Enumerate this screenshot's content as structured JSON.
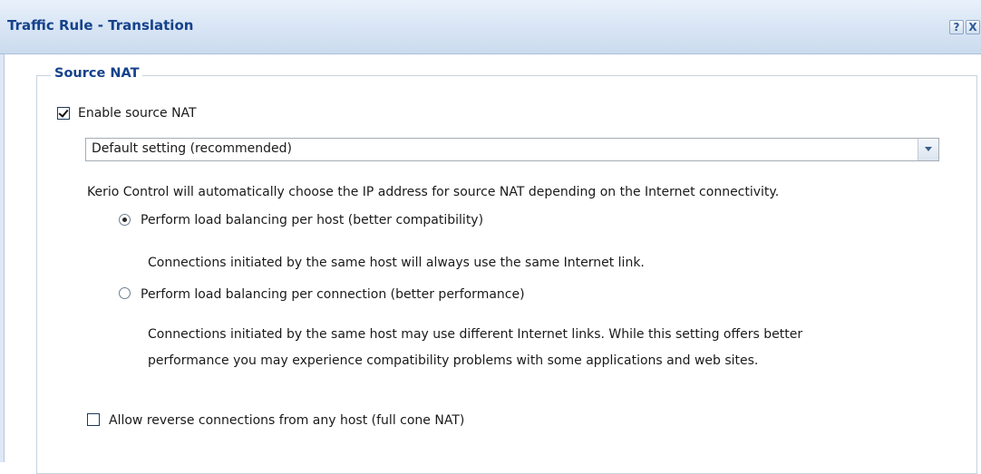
{
  "window": {
    "title": "Traffic Rule - Translation",
    "help_label": "?",
    "close_label": "X"
  },
  "source_nat": {
    "legend": "Source NAT",
    "enable_label": "Enable source NAT",
    "enable_checked": true,
    "mode_select": {
      "value": "Default setting (recommended)"
    },
    "description": "Kerio Control will automatically choose the IP address for source NAT depending on the Internet connectivity.",
    "options": [
      {
        "label": "Perform load balancing per host (better compatibility)",
        "selected": true,
        "help": "Connections initiated by the same host will always use the same Internet link."
      },
      {
        "label": "Perform load balancing per connection (better performance)",
        "selected": false,
        "help_line1": "Connections initiated by the same host may use different Internet links. While this setting offers better",
        "help_line2": "performance you may experience compatibility problems with some applications and web sites."
      }
    ],
    "full_cone_label": "Allow reverse connections from any host (full cone NAT)",
    "full_cone_checked": false
  },
  "colors": {
    "title_text": "#15428b",
    "titlebar_bg": "#d7e4f4",
    "fieldset_border": "#c7d2df"
  }
}
